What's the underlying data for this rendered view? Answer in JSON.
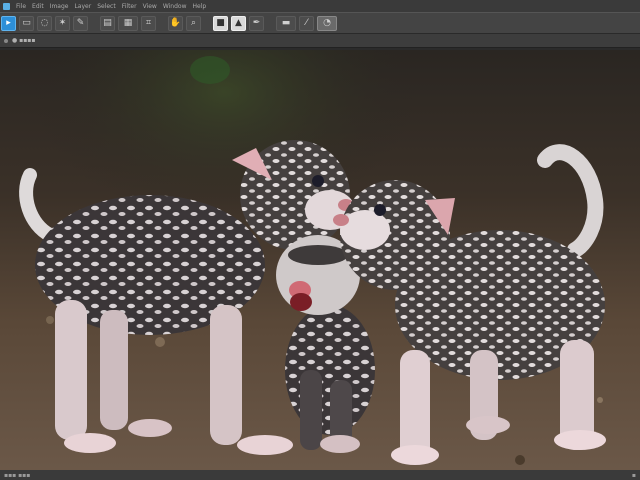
{
  "menubar": {
    "items": [
      "File",
      "Edit",
      "Image",
      "Layer",
      "Select",
      "Filter",
      "View",
      "Window",
      "Help"
    ]
  },
  "toolbar": {
    "tools": [
      {
        "name": "move-tool-icon",
        "glyph": "▸",
        "active": true
      },
      {
        "name": "marquee-tool-icon",
        "glyph": "▭"
      },
      {
        "name": "lasso-tool-icon",
        "glyph": "◌"
      },
      {
        "name": "magic-wand-icon",
        "glyph": "✶"
      },
      {
        "name": "brush-tool-icon",
        "glyph": "✎"
      },
      {
        "name": "stamp-tool-icon",
        "glyph": "▤"
      },
      {
        "name": "gradient-tool-icon",
        "glyph": "▦"
      },
      {
        "name": "crop-tool-icon",
        "glyph": "⌗"
      },
      {
        "name": "hand-tool-icon",
        "glyph": "✋"
      },
      {
        "name": "zoom-tool-icon",
        "glyph": "⌕"
      },
      {
        "name": "foreground-color-icon",
        "glyph": "■",
        "light": true
      },
      {
        "name": "triangle-shape-icon",
        "glyph": "▲",
        "light": true
      },
      {
        "name": "pen-tool-icon",
        "glyph": "✒"
      },
      {
        "name": "layers-icon",
        "glyph": "▬"
      },
      {
        "name": "eyedropper-icon",
        "glyph": "⁄"
      },
      {
        "name": "history-icon",
        "glyph": "◔",
        "highlight": true
      }
    ]
  },
  "optionsbar": {
    "label": "● ▪▪▪▪"
  },
  "canvas": {
    "description_alt": "photo"
  },
  "statusbar": {
    "left": "▪▪▪ ▪▪▪",
    "right": "▪"
  }
}
